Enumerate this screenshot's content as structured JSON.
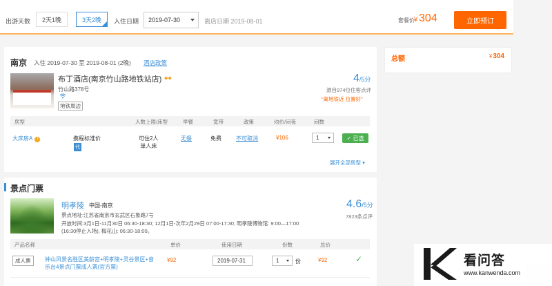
{
  "booking_bar": {
    "days_label": "出游天数",
    "options": [
      "2天1晚",
      "3天2晚"
    ],
    "checkin_label": "入住日期",
    "checkin_value": "2019-07-30",
    "checkout_text": "离店日期 2019-08-01",
    "package_price_label": "套餐价",
    "currency": "¥",
    "price": "304",
    "book_button": "立即预订"
  },
  "summary": {
    "label": "总额",
    "currency": "¥",
    "value": "304"
  },
  "hotel_section": {
    "city": "南京",
    "stay_info": "入住 2019-07-30 至 2019-08-01 (2晚)",
    "policy_link": "酒店政策",
    "hotel": {
      "name": "布丁酒店(南京竹山路地铁站店)",
      "crown_icon": "crown-icon",
      "address": "竹山路378号",
      "near_tag": "地铁周边",
      "score": "4",
      "score_suffix": "/5分",
      "reviews": "源自974位住客点评",
      "quote": "“离地铁近 位置好”"
    },
    "table_headers": [
      "房型",
      "人数上限/床型",
      "早餐",
      "宽带",
      "政策",
      "均价/间夜",
      "间数"
    ],
    "room": {
      "type": "大床房A",
      "std_price": "携程标准价",
      "dai_tag": "代",
      "occupancy_line1": "可住2人",
      "occupancy_line2": "单人床",
      "meal": "无餐",
      "wifi": "免费",
      "cancel": "不可取消",
      "rate": "¥106",
      "qty": "1",
      "selected": "✓ 已选"
    },
    "expand_link": "展开全部房型 ▾"
  },
  "scenic_section": {
    "title": "景点门票",
    "spot": {
      "name": "明孝陵",
      "region": "中国-南京",
      "address": "景点地址:江苏省南京市玄武区石象路7号",
      "hours": "开放时间:3月1日-11月30日 06:30-18:30; 12月1日-次年2月29日 07:00-17:30; 明孝陵博物馆: 9:00—17:00 (16:30停止入场), 梅花山: 06:30-18:00。",
      "score": "4.6",
      "score_suffix": "/5分",
      "reviews": "7823条点评"
    },
    "table_headers": [
      "产品名称",
      "单价",
      "使用日期",
      "份数",
      "总价"
    ],
    "ticket": {
      "tag": "成人票",
      "product": "钟山风景名胜区美龄宫+明孝陵+灵谷景区+音乐台4景点门票成人票(官方票)",
      "price": "¥92",
      "use_date": "2019-07-31",
      "qty": "1",
      "unit": "份",
      "total": "¥92"
    }
  },
  "watermark": {
    "text": "看问答",
    "url": "www.kanwenda.com"
  }
}
